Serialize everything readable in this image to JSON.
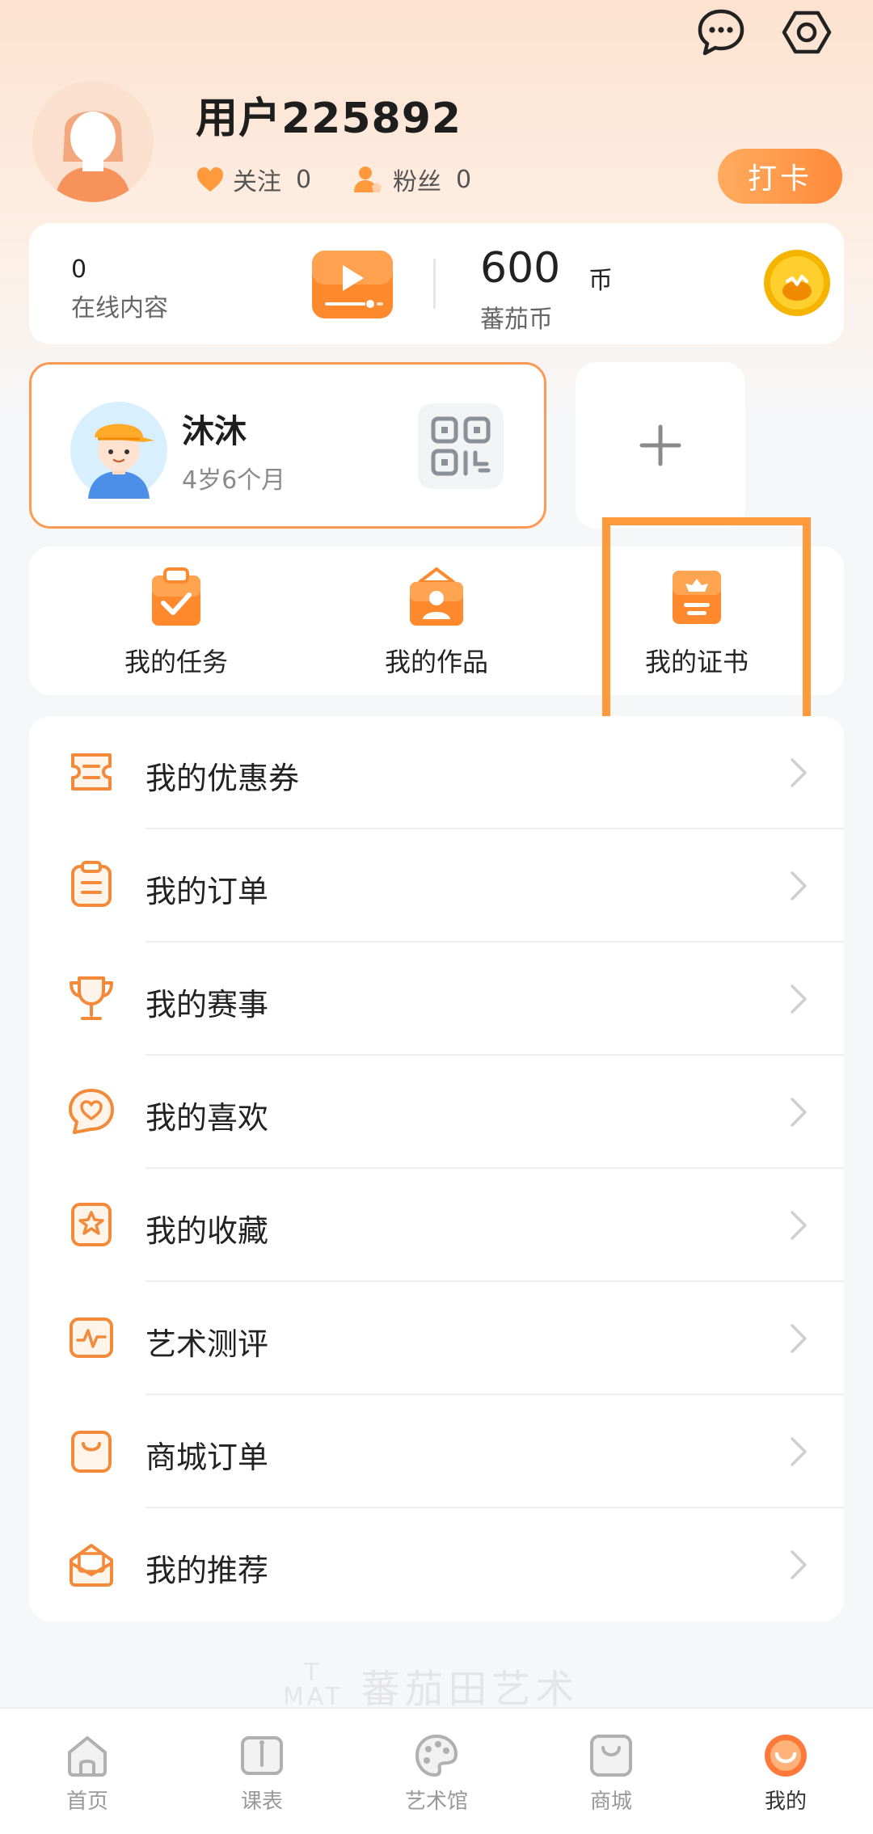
{
  "header": {
    "username": "用户225892",
    "follow_label": "关注",
    "follow_count": "0",
    "fans_label": "粉丝",
    "fans_count": "0",
    "checkin_label": "打卡"
  },
  "top_icons": [
    "message-icon",
    "settings-icon"
  ],
  "stats": {
    "online_count": "0",
    "online_label": "在线内容",
    "coin_amount": "600",
    "coin_unit": "币",
    "coin_label": "蕃茄币"
  },
  "child": {
    "name": "沐沐",
    "age": "4岁6个月"
  },
  "features": [
    {
      "label": "我的任务",
      "icon": "task-clipboard-icon"
    },
    {
      "label": "我的作品",
      "icon": "artwork-frame-icon"
    },
    {
      "label": "我的证书",
      "icon": "certificate-icon"
    }
  ],
  "menu": [
    {
      "label": "我的优惠券",
      "icon": "coupon-icon"
    },
    {
      "label": "我的订单",
      "icon": "order-icon"
    },
    {
      "label": "我的赛事",
      "icon": "trophy-icon"
    },
    {
      "label": "我的喜欢",
      "icon": "heart-icon"
    },
    {
      "label": "我的收藏",
      "icon": "star-bookmark-icon"
    },
    {
      "label": "艺术测评",
      "icon": "pulse-icon"
    },
    {
      "label": "商城订单",
      "icon": "shopping-bag-icon"
    },
    {
      "label": "我的推荐",
      "icon": "mail-icon"
    }
  ],
  "watermark": {
    "logo_top": "T",
    "logo_bottom": "MAT",
    "text": "蕃茄田艺术"
  },
  "tabbar": [
    {
      "label": "首页",
      "icon": "home-icon"
    },
    {
      "label": "课表",
      "icon": "schedule-book-icon"
    },
    {
      "label": "艺术馆",
      "icon": "palette-icon"
    },
    {
      "label": "商城",
      "icon": "shop-bag-icon"
    },
    {
      "label": "我的",
      "icon": "profile-smile-icon",
      "active": true
    }
  ],
  "colors": {
    "accent": "#ff8a3a",
    "accent_light": "#ffab5e",
    "highlight_border": "#ff9a3c",
    "background": "#f6f7f9"
  }
}
